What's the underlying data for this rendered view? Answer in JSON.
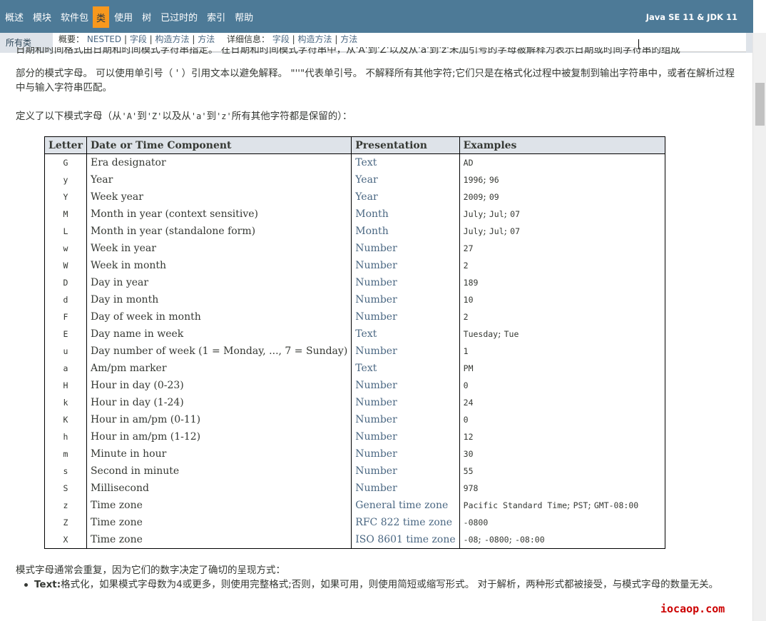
{
  "topnav": {
    "items": [
      "概述",
      "模块",
      "软件包",
      "类",
      "使用",
      "树",
      "已过时的",
      "索引",
      "帮助"
    ],
    "active_index": 3,
    "brand": "Java SE 11 & JDK 11"
  },
  "subnav": {
    "all_classes": "所有类",
    "summary_label": "概要：",
    "summary_links": [
      "NESTED",
      "字段",
      "构造方法",
      "方法"
    ],
    "detail_label": "详细信息：",
    "detail_links": [
      "字段",
      "构造方法",
      "方法"
    ]
  },
  "content": {
    "cut_line": "日期和时间格式由日期和时间模式字符串指定。 在日期和时间模式字符串中，从'A'到'Z'以及从'a'到'z'未加引号的字母被解释为表示日期或时间字符串的组成",
    "p1": "部分的模式字母。 可以使用单引号（ ' ）引用文本以避免解释。 \"''\"代表单引号。 不解释所有其他字符;它们只是在格式化过程中被复制到输出字符串中，或者在解析过程中与输入字符串匹配。",
    "p2_pre": "定义了以下模式字母（从",
    "p2_a": "'A'",
    "p2_to1": "到",
    "p2_z": "'Z'",
    "p2_mid": "以及从",
    "p2_a2": "'a'",
    "p2_to2": "到",
    "p2_z2": "'z'",
    "p2_post": "所有其他字符都是保留的）：",
    "p3": "模式字母通常会重复，因为它们的数字决定了确切的呈现方式：",
    "bullet_bold": "Text:",
    "bullet_text": "格式化，如果模式字母数为4或更多，则使用完整格式;否则，如果可用，则使用简短或缩写形式。 对于解析，两种形式都被接受，与模式字母的数量无关。"
  },
  "table": {
    "headers": [
      "Letter",
      "Date or Time Component",
      "Presentation",
      "Examples"
    ],
    "rows": [
      {
        "letter": "G",
        "component": "Era designator",
        "presentation": "Text",
        "examples": [
          "AD"
        ]
      },
      {
        "letter": "y",
        "component": "Year",
        "presentation": "Year",
        "examples": [
          "1996",
          "96"
        ]
      },
      {
        "letter": "Y",
        "component": "Week year",
        "presentation": "Year",
        "examples": [
          "2009",
          "09"
        ]
      },
      {
        "letter": "M",
        "component": "Month in year (context sensitive)",
        "presentation": "Month",
        "examples": [
          "July",
          "Jul",
          "07"
        ]
      },
      {
        "letter": "L",
        "component": "Month in year (standalone form)",
        "presentation": "Month",
        "examples": [
          "July",
          "Jul",
          "07"
        ]
      },
      {
        "letter": "w",
        "component": "Week in year",
        "presentation": "Number",
        "examples": [
          "27"
        ]
      },
      {
        "letter": "W",
        "component": "Week in month",
        "presentation": "Number",
        "examples": [
          "2"
        ]
      },
      {
        "letter": "D",
        "component": "Day in year",
        "presentation": "Number",
        "examples": [
          "189"
        ]
      },
      {
        "letter": "d",
        "component": "Day in month",
        "presentation": "Number",
        "examples": [
          "10"
        ]
      },
      {
        "letter": "F",
        "component": "Day of week in month",
        "presentation": "Number",
        "examples": [
          "2"
        ]
      },
      {
        "letter": "E",
        "component": "Day name in week",
        "presentation": "Text",
        "examples": [
          "Tuesday",
          "Tue"
        ]
      },
      {
        "letter": "u",
        "component": "Day number of week (1 = Monday, ..., 7 = Sunday)",
        "presentation": "Number",
        "examples": [
          "1"
        ]
      },
      {
        "letter": "a",
        "component": "Am/pm marker",
        "presentation": "Text",
        "examples": [
          "PM"
        ]
      },
      {
        "letter": "H",
        "component": "Hour in day (0-23)",
        "presentation": "Number",
        "examples": [
          "0"
        ]
      },
      {
        "letter": "k",
        "component": "Hour in day (1-24)",
        "presentation": "Number",
        "examples": [
          "24"
        ]
      },
      {
        "letter": "K",
        "component": "Hour in am/pm (0-11)",
        "presentation": "Number",
        "examples": [
          "0"
        ]
      },
      {
        "letter": "h",
        "component": "Hour in am/pm (1-12)",
        "presentation": "Number",
        "examples": [
          "12"
        ]
      },
      {
        "letter": "m",
        "component": "Minute in hour",
        "presentation": "Number",
        "examples": [
          "30"
        ]
      },
      {
        "letter": "s",
        "component": "Second in minute",
        "presentation": "Number",
        "examples": [
          "55"
        ]
      },
      {
        "letter": "S",
        "component": "Millisecond",
        "presentation": "Number",
        "examples": [
          "978"
        ]
      },
      {
        "letter": "z",
        "component": "Time zone",
        "presentation": "General time zone",
        "examples": [
          "Pacific Standard Time",
          "PST",
          "GMT-08:00"
        ]
      },
      {
        "letter": "Z",
        "component": "Time zone",
        "presentation": "RFC 822 time zone",
        "examples": [
          "-0800"
        ]
      },
      {
        "letter": "X",
        "component": "Time zone",
        "presentation": "ISO 8601 time zone",
        "examples": [
          "-08",
          "-0800",
          "-08:00"
        ]
      }
    ]
  },
  "watermark": "iocaop.com"
}
